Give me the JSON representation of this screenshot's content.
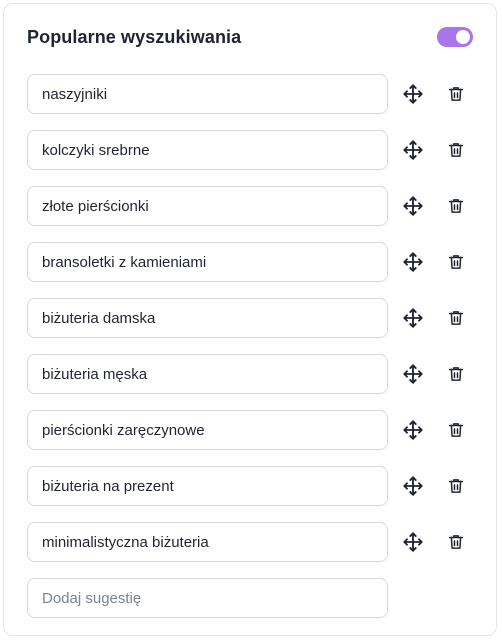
{
  "panel": {
    "title": "Popularne wyszukiwania",
    "toggle": {
      "enabled": true,
      "color": "#a876e9"
    }
  },
  "items": [
    {
      "value": "naszyjniki",
      "move_icon": "move-arrows-icon",
      "delete_icon": "trash-icon"
    },
    {
      "value": "kolczyki srebrne",
      "move_icon": "move-arrows-icon",
      "delete_icon": "trash-icon"
    },
    {
      "value": "złote pierścionki",
      "move_icon": "move-arrows-icon",
      "delete_icon": "trash-icon"
    },
    {
      "value": "bransoletki z kamieniami",
      "move_icon": "move-arrows-icon",
      "delete_icon": "trash-icon"
    },
    {
      "value": "biżuteria damska",
      "move_icon": "move-arrows-icon",
      "delete_icon": "trash-icon"
    },
    {
      "value": "biżuteria męska",
      "move_icon": "move-arrows-icon",
      "delete_icon": "trash-icon"
    },
    {
      "value": "pierścionki zaręczynowe",
      "move_icon": "move-arrows-icon",
      "delete_icon": "trash-icon"
    },
    {
      "value": "biżuteria na prezent",
      "move_icon": "move-arrows-icon",
      "delete_icon": "trash-icon"
    },
    {
      "value": "minimalistyczna biżuteria",
      "move_icon": "move-arrows-icon",
      "delete_icon": "trash-icon"
    }
  ],
  "new_item": {
    "value": "",
    "placeholder": "Dodaj sugestię"
  }
}
